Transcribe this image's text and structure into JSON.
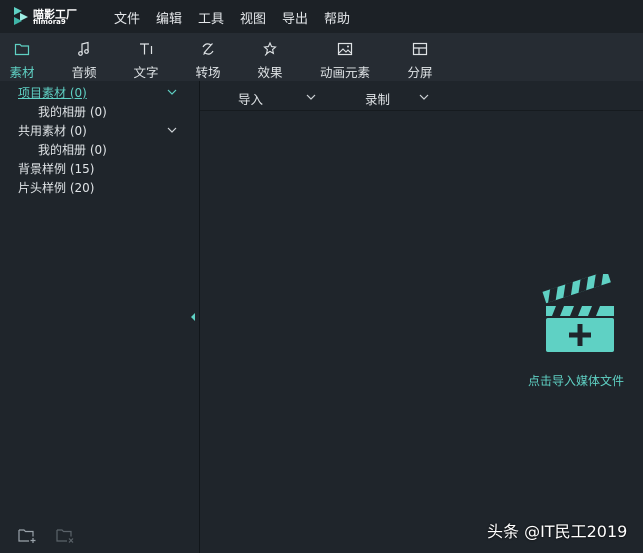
{
  "app": {
    "logo_text": "喵影工厂",
    "logo_sub": "filmora9"
  },
  "menu": [
    "文件",
    "编辑",
    "工具",
    "视图",
    "导出",
    "帮助"
  ],
  "toolbar": {
    "items": [
      {
        "label": "素材",
        "icon": "folder-icon"
      },
      {
        "label": "音频",
        "icon": "music-note-icon"
      },
      {
        "label": "文字",
        "icon": "text-icon"
      },
      {
        "label": "转场",
        "icon": "transition-icon"
      },
      {
        "label": "效果",
        "icon": "effects-icon"
      },
      {
        "label": "动画元素",
        "icon": "image-icon"
      },
      {
        "label": "分屏",
        "icon": "split-screen-icon"
      }
    ],
    "active": "素材"
  },
  "sidebar": {
    "items": [
      {
        "label": "项目素材 (0)"
      },
      {
        "label": "我的相册 (0)"
      },
      {
        "label": "共用素材 (0)"
      },
      {
        "label": "我的相册 (0)"
      },
      {
        "label": "背景样例 (15)"
      },
      {
        "label": "片头样例 (20)"
      }
    ]
  },
  "filters": {
    "import_label": "导入",
    "record_label": "录制"
  },
  "media": {
    "import_prompt": "点击导入媒体文件"
  },
  "watermark": "头条 @IT民工2019",
  "colors": {
    "accent": "#5fd1c4",
    "background": "#1f252b",
    "toolbar": "#262c33"
  }
}
